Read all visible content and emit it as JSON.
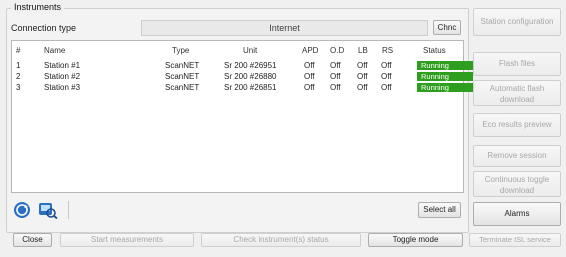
{
  "group": {
    "title": "Instruments",
    "connection_label": "Connection type",
    "connection_value": "Internet",
    "change_button": "Chnc"
  },
  "table": {
    "headers": [
      "#",
      "Name",
      "Type",
      "Unit",
      "APD",
      "O.D",
      "LB",
      "RS",
      "Status"
    ],
    "rows": [
      {
        "num": "1",
        "name": "Station #1",
        "type": "ScanNET",
        "unit": "Sr 200 #26951",
        "apd": "Off",
        "od": "Off",
        "lb": "Off",
        "rs": "Off",
        "status": "Running"
      },
      {
        "num": "2",
        "name": "Station #2",
        "type": "ScanNET",
        "unit": "Sr 200 #26880",
        "apd": "Off",
        "od": "Off",
        "lb": "Off",
        "rs": "Off",
        "status": "Running"
      },
      {
        "num": "3",
        "name": "Station #3",
        "type": "ScanNET",
        "unit": "Sr 200 #26851",
        "apd": "Off",
        "od": "Off",
        "lb": "Off",
        "rs": "Off",
        "status": "Running"
      }
    ]
  },
  "select_all": "Select all",
  "bottom": {
    "close": "Close",
    "start_measurements": "Start measurements",
    "check_status": "Check instrument(s) status",
    "toggle_mode": "Toggle mode",
    "terminate": "Terminate ISL service"
  },
  "right_panel": {
    "station_config": "Station configuration",
    "flash_files": "Flash files",
    "automatic_flash": "Automatic flash download",
    "eco_results": "Eco results preview",
    "remove_session": "Remove session",
    "continuous_toggle": "Continuous toggle download",
    "alarms": "Alarms"
  },
  "colors": {
    "status_running": "#2e9e1e",
    "icon_blue": "#2b6fc0"
  },
  "icons": [
    "refresh-icon",
    "instrument-search-icon"
  ]
}
